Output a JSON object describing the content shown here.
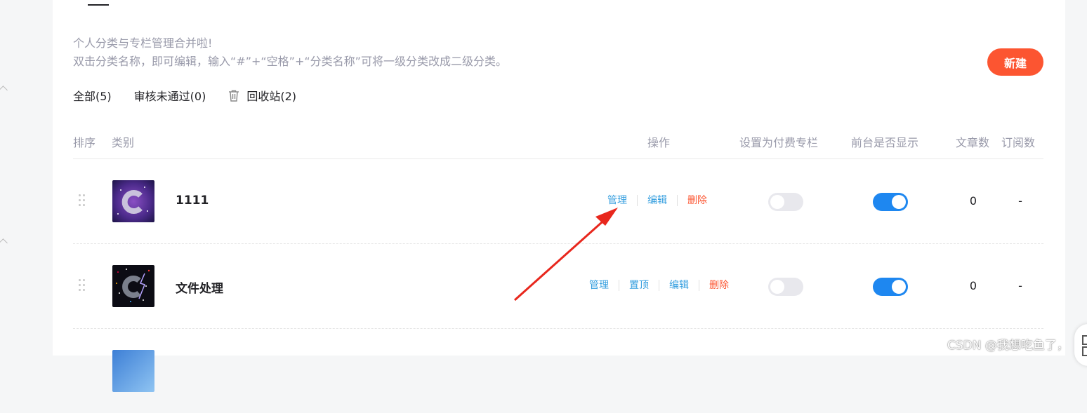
{
  "notice": {
    "line1": "个人分类与专栏管理合并啦!",
    "line2": "双击分类名称，即可编辑，输入“#”+“空格”+“分类名称”可将一级分类改成二级分类。"
  },
  "new_button": "新建",
  "filters": [
    {
      "label": "全部(5)"
    },
    {
      "label": "审核未通过(0)"
    },
    {
      "label": "回收站(2)"
    }
  ],
  "table_headers": {
    "sort": "排序",
    "category": "类别",
    "actions": "操作",
    "paid": "设置为付费专栏",
    "visible": "前台是否显示",
    "articles": "文章数",
    "subs": "订阅数"
  },
  "rows": [
    {
      "name": "1111",
      "actions": [
        "管理",
        "编辑",
        "删除"
      ],
      "paid_enabled": false,
      "visible_enabled": true,
      "articles": "0",
      "subs": "-"
    },
    {
      "name": "文件处理",
      "actions": [
        "管理",
        "置顶",
        "编辑",
        "删除"
      ],
      "paid_enabled": false,
      "visible_enabled": true,
      "articles": "0",
      "subs": "-"
    }
  ],
  "watermark": "CSDN @我想吃鱼了，",
  "colors": {
    "accent": "#fc5531",
    "link": "#349edf",
    "toggle_on": "#1e87f0",
    "toggle_off": "#e8e8ed",
    "arrow": "#e8271d"
  },
  "icons": [
    "trash-icon",
    "drag-handle-icon",
    "annotation-arrow",
    "qr-icon"
  ]
}
